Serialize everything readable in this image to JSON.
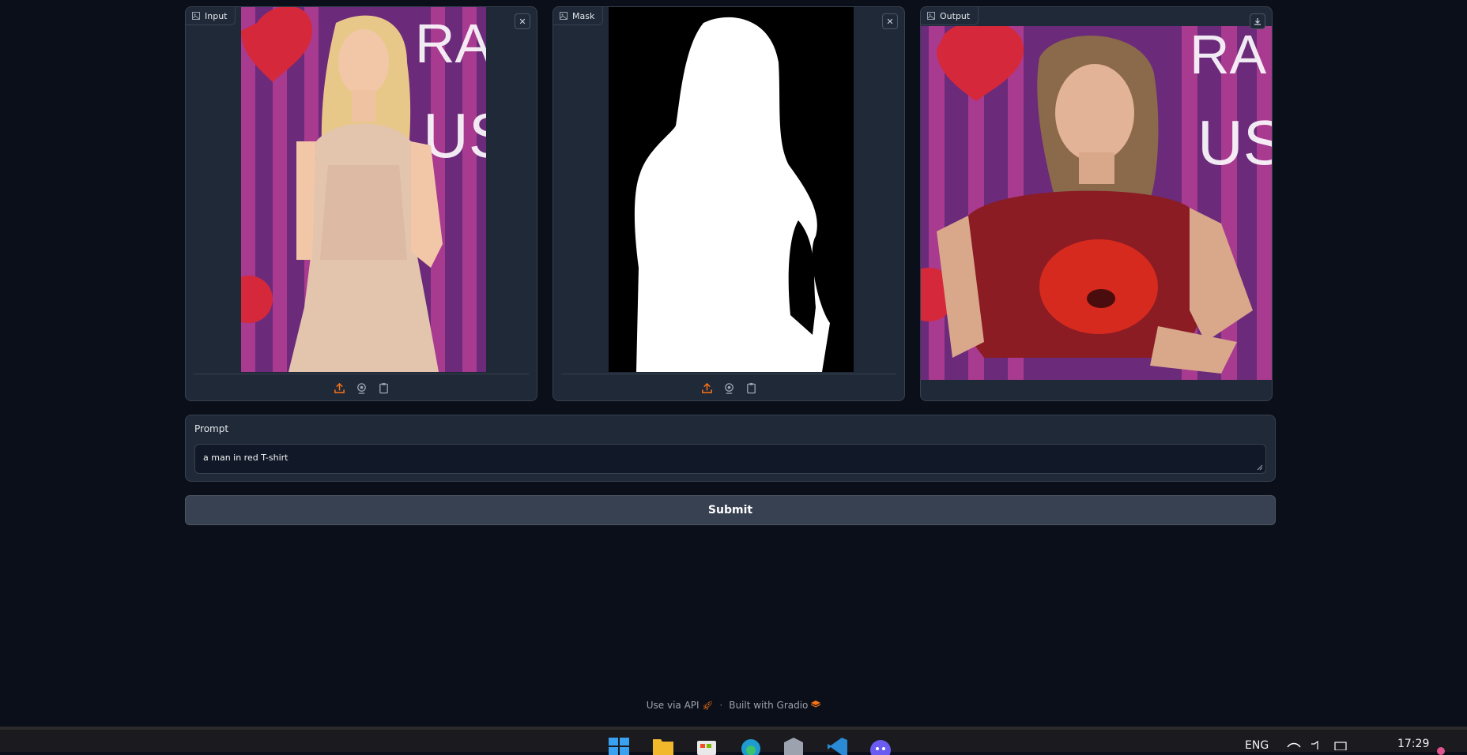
{
  "panels": {
    "input": {
      "label": "Input"
    },
    "mask": {
      "label": "Mask"
    },
    "output": {
      "label": "Output"
    }
  },
  "prompt": {
    "label": "Prompt",
    "value": "a man in red T-shirt"
  },
  "submit_label": "Submit",
  "footer": {
    "api_label": "Use via API",
    "separator": "·",
    "built_label": "Built with Gradio"
  },
  "taskbar": {
    "language": "ENG",
    "time": "17:29"
  },
  "colors": {
    "background": "#0b0f19",
    "panel": "#1f2937",
    "border": "#374151",
    "accent": "#f97316"
  }
}
